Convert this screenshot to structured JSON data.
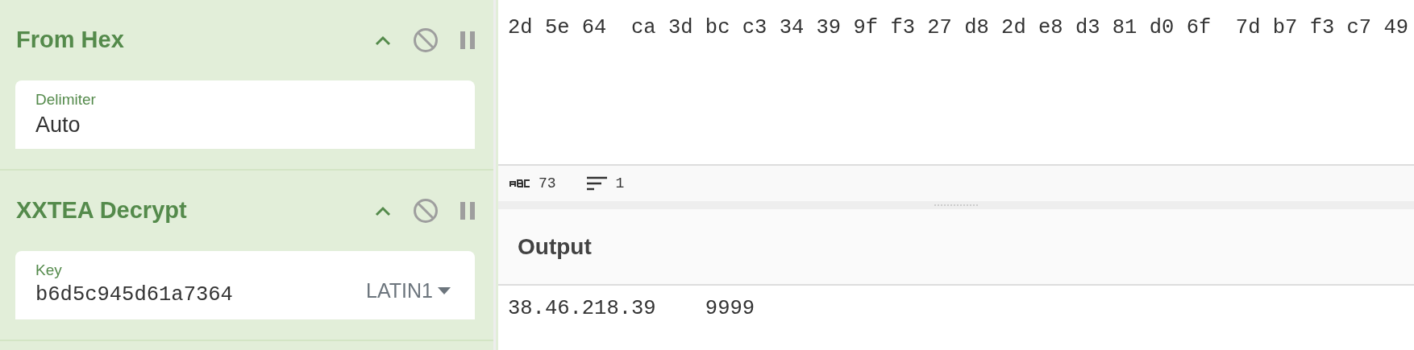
{
  "recipe": [
    {
      "title": "From Hex",
      "field": {
        "kind": "option",
        "label": "Delimiter",
        "value": "Auto"
      }
    },
    {
      "title": "XXTEA Decrypt",
      "field": {
        "kind": "key",
        "label": "Key",
        "value": "b6d5c945d61a7364",
        "encoding": "LATIN1"
      }
    }
  ],
  "input": {
    "text": "2d 5e 64  ca 3d bc c3 34 39 9f f3 27 d8 2d e8 d3 81 d0 6f  7d b7 f3 c7 49"
  },
  "status_bar": {
    "length": "73",
    "lines": "1"
  },
  "output": {
    "title": "Output",
    "text": "38.46.218.39    9999"
  }
}
